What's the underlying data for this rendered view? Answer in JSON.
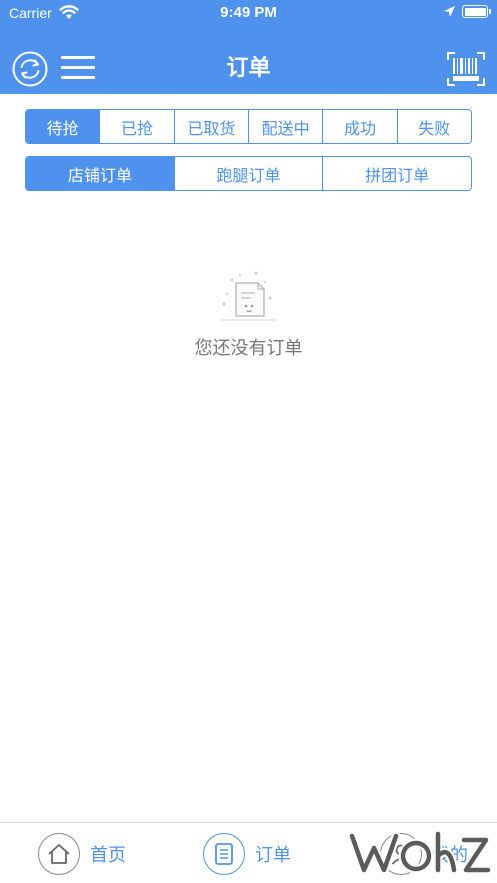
{
  "status_bar": {
    "carrier": "Carrier",
    "time": "9:49 PM"
  },
  "nav": {
    "title": "订单",
    "left_icons": [
      "refresh-icon",
      "menu-icon"
    ],
    "right_icon": "barcode-scan-icon"
  },
  "status_tabs": [
    {
      "label": "待抢",
      "active": true
    },
    {
      "label": "已抢",
      "active": false
    },
    {
      "label": "已取货",
      "active": false
    },
    {
      "label": "配送中",
      "active": false
    },
    {
      "label": "成功",
      "active": false
    },
    {
      "label": "失败",
      "active": false
    }
  ],
  "type_tabs": [
    {
      "label": "店铺订单",
      "active": true
    },
    {
      "label": "跑腿订单",
      "active": false
    },
    {
      "label": "拼团订单",
      "active": false
    }
  ],
  "empty_state": {
    "icon": "empty-document-icon",
    "message": "您还没有订单"
  },
  "tab_bar": [
    {
      "label": "首页",
      "icon": "home-icon"
    },
    {
      "label": "订单",
      "icon": "order-list-icon"
    },
    {
      "label": "我的",
      "icon": "profile-icon"
    }
  ],
  "colors": {
    "primary": "#4f92ee",
    "text_muted": "#777777",
    "divider": "#d6d6d6"
  }
}
